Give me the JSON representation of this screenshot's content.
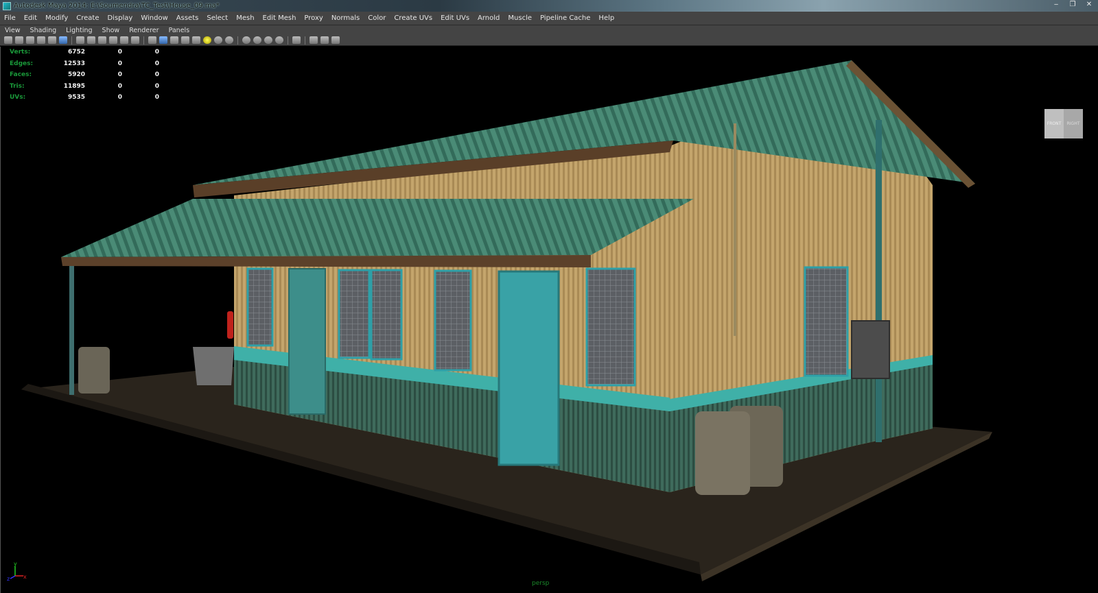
{
  "window": {
    "title": "Autodesk Maya 2014: E:\\Soumendra\\TC_Test\\House_09.ma*",
    "controls": [
      "‒",
      "❐",
      "✕"
    ]
  },
  "menubar": [
    "File",
    "Edit",
    "Modify",
    "Create",
    "Display",
    "Window",
    "Assets",
    "Select",
    "Mesh",
    "Edit Mesh",
    "Proxy",
    "Normals",
    "Color",
    "Create UVs",
    "Edit UVs",
    "Arnold",
    "Muscle",
    "Pipeline Cache",
    "Help"
  ],
  "panel_menu": [
    "View",
    "Shading",
    "Lighting",
    "Show",
    "Renderer",
    "Panels"
  ],
  "toolbar_icons": [
    "camera-attributes-icon",
    "bookmark-icon",
    "image-plane-icon",
    "2d-pan-icon",
    "grease-pencil-icon",
    "grid-icon",
    "film-gate-icon",
    "resolution-gate-icon",
    "gate-mask-icon",
    "field-chart-icon",
    "safe-action-icon",
    "safe-title-icon",
    "wireframe-icon",
    "smooth-shade-icon",
    "default-material-icon",
    "shaded-wireframe-icon",
    "textured-icon",
    "use-all-lights-icon",
    "shadows-icon",
    "screen-space-ao-icon",
    "motion-blur-icon",
    "anti-aliasing-icon",
    "depth-of-field-icon",
    "isolate-select-icon",
    "xray-icon",
    "xray-joints-icon",
    "xray-components-icon"
  ],
  "hud": {
    "rows": [
      {
        "label": "Verts:",
        "a": "6752",
        "b": "0",
        "c": "0"
      },
      {
        "label": "Edges:",
        "a": "12533",
        "b": "0",
        "c": "0"
      },
      {
        "label": "Faces:",
        "a": "5920",
        "b": "0",
        "c": "0"
      },
      {
        "label": "Tris:",
        "a": "11895",
        "b": "0",
        "c": "0"
      },
      {
        "label": "UVs:",
        "a": "9535",
        "b": "0",
        "c": "0"
      }
    ]
  },
  "viewcube": {
    "front": "FRONT",
    "right": "RIGHT"
  },
  "camera_label": "persp",
  "axis": {
    "y": "y",
    "x": "x",
    "z": "z"
  },
  "colors": {
    "hud_label": "#1a9a3a",
    "camera_label": "#1a8a2a",
    "menu_bg": "#444444",
    "viewport_bg": "#000000"
  }
}
